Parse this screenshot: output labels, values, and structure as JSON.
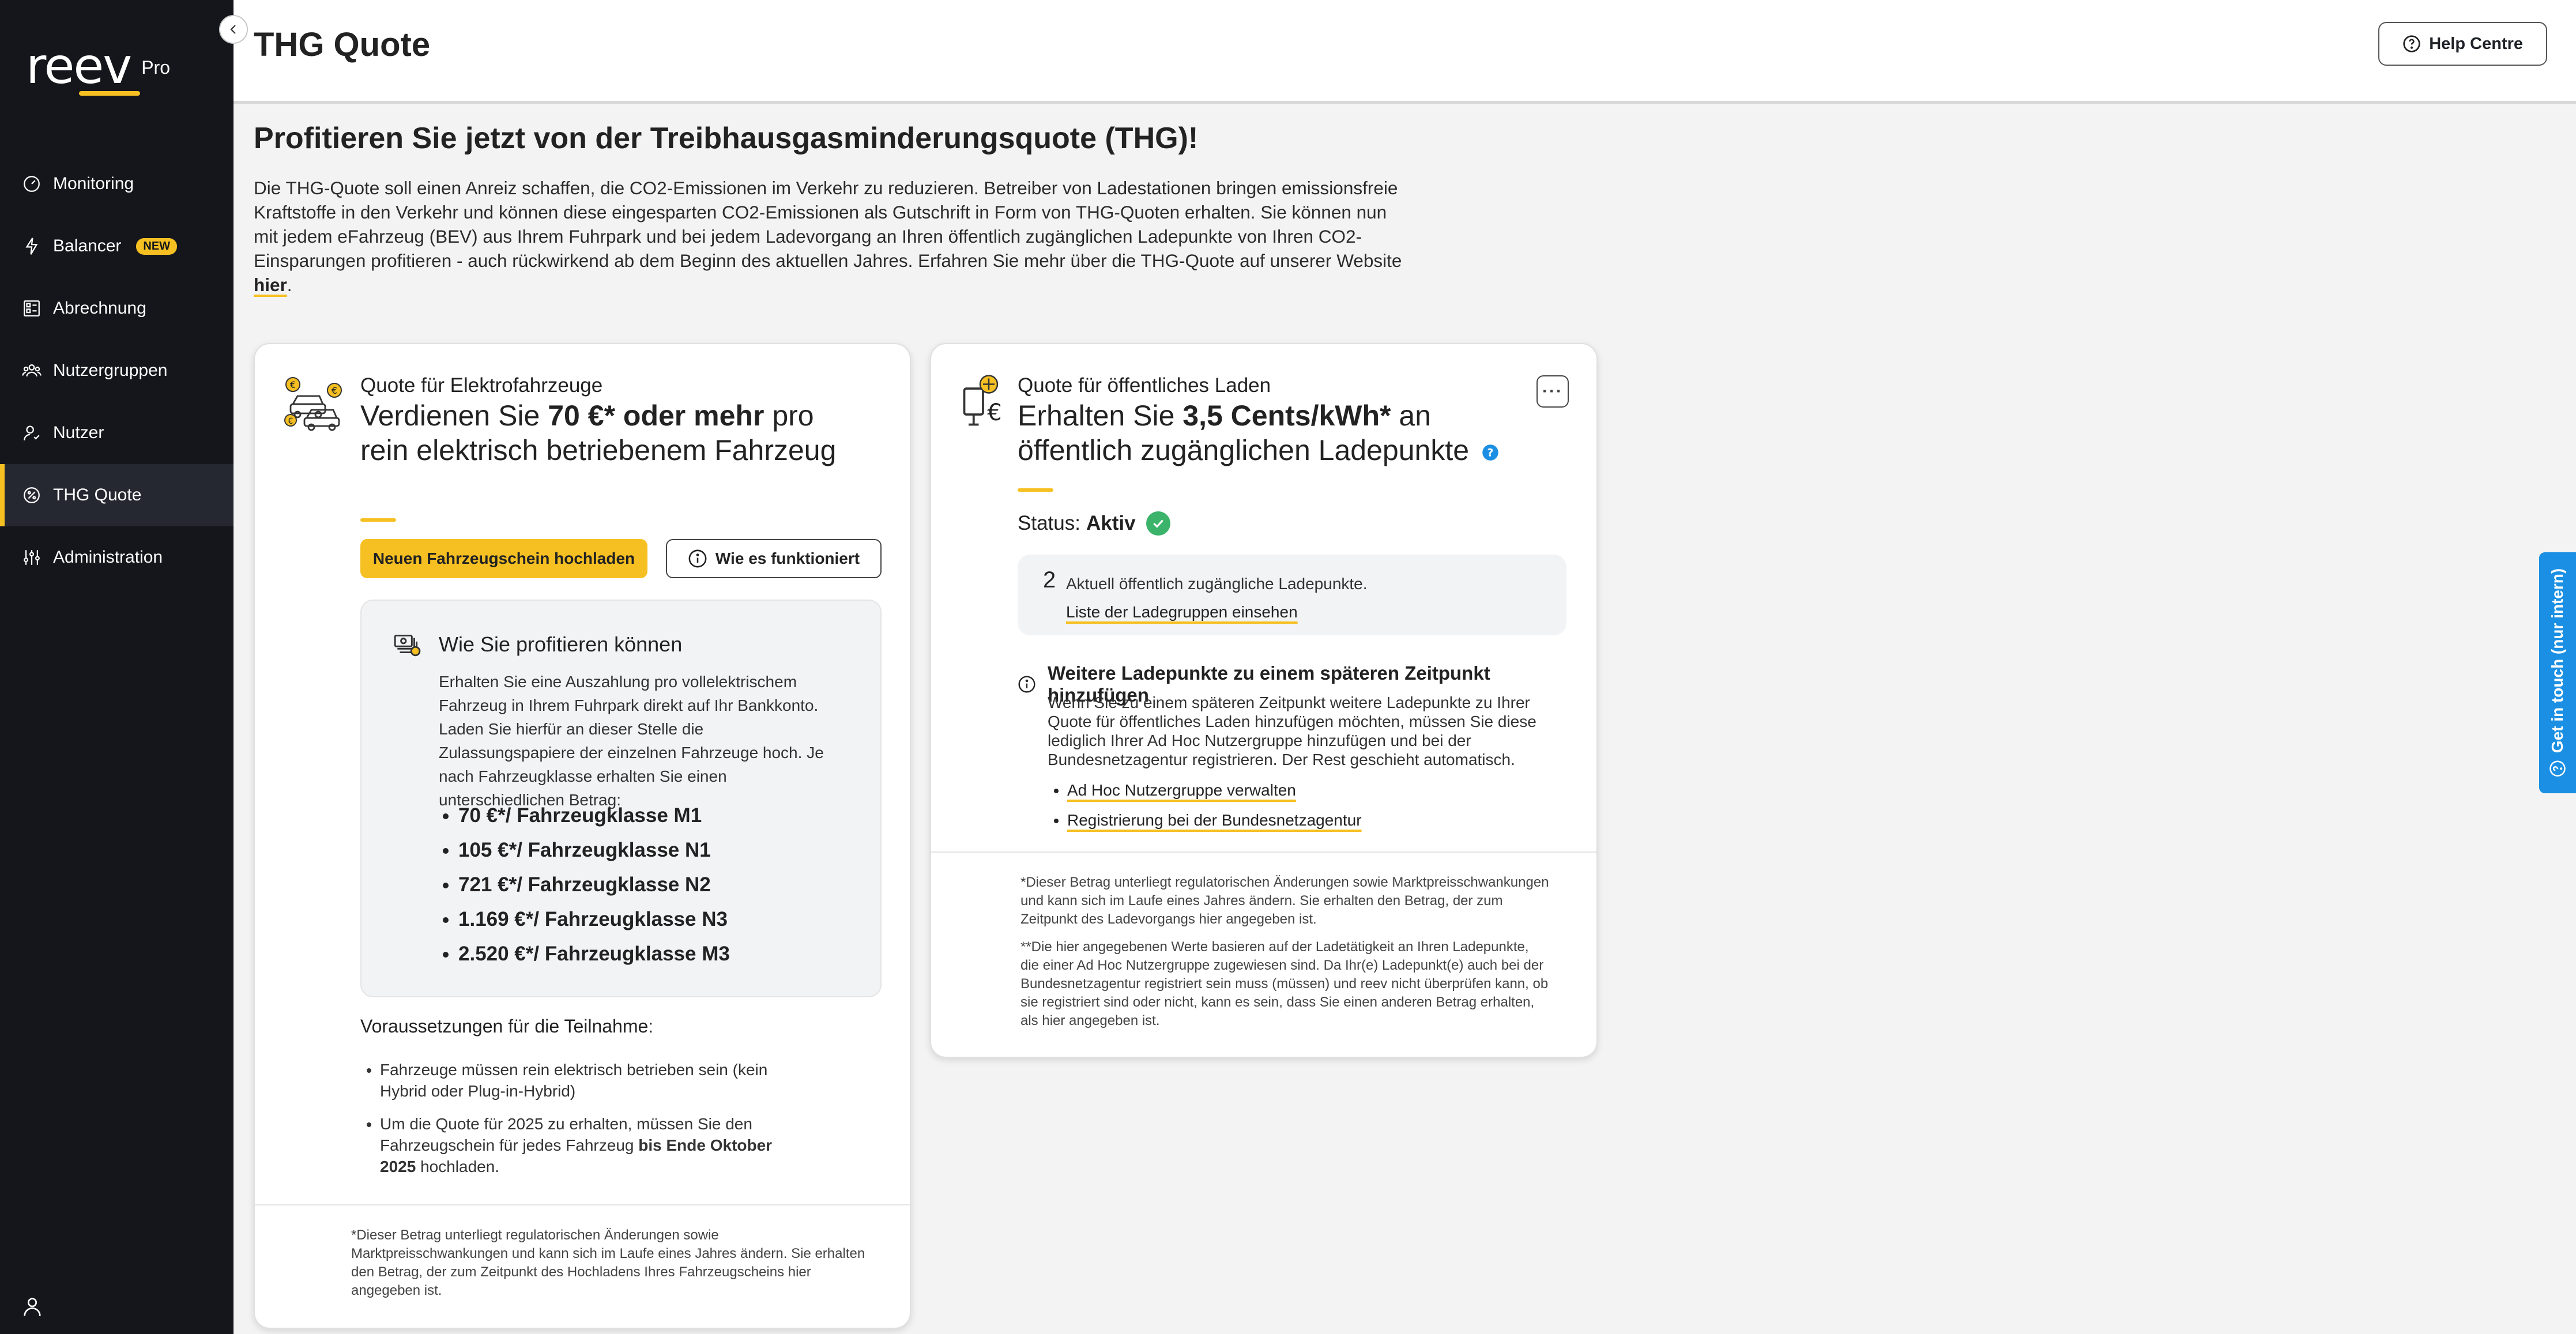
{
  "brand": {
    "name": "reev",
    "suffix": "Pro",
    "accent": "#f6c022"
  },
  "sidebar": {
    "items": [
      {
        "label": "Monitoring",
        "icon": "gauge-icon"
      },
      {
        "label": "Balancer",
        "icon": "lightning-icon",
        "badge": "NEW"
      },
      {
        "label": "Abrechnung",
        "icon": "invoice-grid-icon"
      },
      {
        "label": "Nutzergruppen",
        "icon": "user-group-icon"
      },
      {
        "label": "Nutzer",
        "icon": "user-icon"
      },
      {
        "label": "THG Quote",
        "icon": "percent-leaf-icon",
        "active": true
      },
      {
        "label": "Administration",
        "icon": "sliders-icon"
      }
    ]
  },
  "header": {
    "title": "THG Quote",
    "help_label": "Help Centre"
  },
  "main": {
    "headline": "Profitieren Sie jetzt von der Treibhausgasminderungsquote (THG)!",
    "intro_text": "Die THG-Quote soll einen Anreiz schaffen, die CO2-Emissionen im Verkehr zu reduzieren. Betreiber von Ladestationen bringen emissionsfreie Kraftstoffe in den Verkehr und können diese eingesparten CO2-Emissionen als Gutschrift in Form von THG-Quoten erhalten. Sie können nun mit jedem eFahrzeug (BEV) aus Ihrem Fuhrpark und bei jedem Ladevorgang an Ihren öffentlich zugänglichen Ladepunkte von Ihren CO2-Einsparungen profitieren - auch rückwirkend ab dem Beginn des aktuellen Jahres. Erfahren Sie mehr über die THG-Quote auf unserer Website",
    "intro_link": "hier",
    "intro_end": "."
  },
  "card_vehicles": {
    "subtitle": "Quote für Elektrofahrzeuge",
    "title_pre": "Verdienen Sie ",
    "title_bold": "70 €* oder mehr",
    "title_post": " pro rein elektrisch betriebenem Fahrzeug",
    "upload_button": "Neuen Fahrzeugschein hochladen",
    "how_button": "Wie es funktioniert",
    "benefit_title": "Wie Sie profitieren können",
    "benefit_text": "Erhalten Sie eine Auszahlung pro vollelektrischem Fahrzeug in Ihrem Fuhrpark direkt auf Ihr Bankkonto. Laden Sie hierfür an dieser Stelle die Zulassungspapiere der einzelnen Fahrzeuge hoch. Je nach Fahrzeugklasse erhalten Sie einen unterschiedlichen Betrag:",
    "tiers": [
      "70 €*/ Fahrzeugklasse M1",
      "105 €*/ Fahrzeugklasse N1",
      "721 €*/ Fahrzeugklasse N2",
      "1.169 €*/ Fahrzeugklasse N3",
      "2.520 €*/ Fahrzeugklasse M3"
    ],
    "requirements_title": "Voraussetzungen für die Teilnahme:",
    "req1": "Fahrzeuge müssen rein elektrisch betrieben sein (kein Hybrid oder Plug-in-Hybrid)",
    "req2_pre": "Um die Quote für 2025 zu erhalten, müssen Sie den Fahrzeugschein für jedes Fahrzeug ",
    "req2_bold": "bis Ende Oktober 2025",
    "req2_post": " hochladen.",
    "footnote": "*Dieser Betrag unterliegt regulatorischen Änderungen sowie Marktpreisschwankungen und kann sich im Laufe eines Jahres ändern. Sie erhalten den Betrag, der zum Zeitpunkt des Hochladens Ihres Fahrzeugscheins hier angegeben ist."
  },
  "card_public": {
    "subtitle": "Quote für öffentliches Laden",
    "title_pre": "Erhalten Sie ",
    "title_bold": "3,5 Cents/kWh*",
    "title_post": " an öffentlich zugänglichen Ladepunkte",
    "more_label": "···",
    "status_label": "Status:",
    "status_value": "Aktiv",
    "count": "2",
    "count_text": "Aktuell öffentlich zugängliche Ladepunkte.",
    "count_link": "Liste der Ladegruppen einsehen",
    "add_title": "Weitere Ladepunkte zu einem späteren Zeitpunkt hinzufügen",
    "add_text": "Wenn Sie zu einem späteren Zeitpunkt weitere Ladepunkte zu Ihrer Quote für öffentliches Laden hinzufügen möchten, müssen Sie diese lediglich Ihrer Ad Hoc Nutzergruppe hinzufügen und bei der Bundesnetzagentur registrieren. Der Rest geschieht automatisch.",
    "links": [
      "Ad Hoc Nutzergruppe verwalten",
      "Registrierung bei der Bundesnetzagentur"
    ],
    "footnote1": "*Dieser Betrag unterliegt regulatorischen Änderungen sowie Marktpreisschwankungen und kann sich im Laufe eines Jahres ändern. Sie erhalten den Betrag, der zum Zeitpunkt des Ladevorgangs hier angegeben ist.",
    "footnote2": "**Die hier angegebenen Werte basieren auf der Ladetätigkeit an Ihren Ladepunkte, die einer Ad Hoc Nutzergruppe zugewiesen sind. Da Ihr(e) Ladepunkt(e) auch bei der Bundesnetzagentur registriert sein muss (müssen) und reev nicht überprüfen kann, ob sie registriert sind oder nicht, kann es sein, dass Sie einen anderen Betrag erhalten, als hier angegeben ist."
  },
  "side_tab": {
    "label": "Get in touch (nur intern)",
    "color": "#1a8fe3"
  }
}
